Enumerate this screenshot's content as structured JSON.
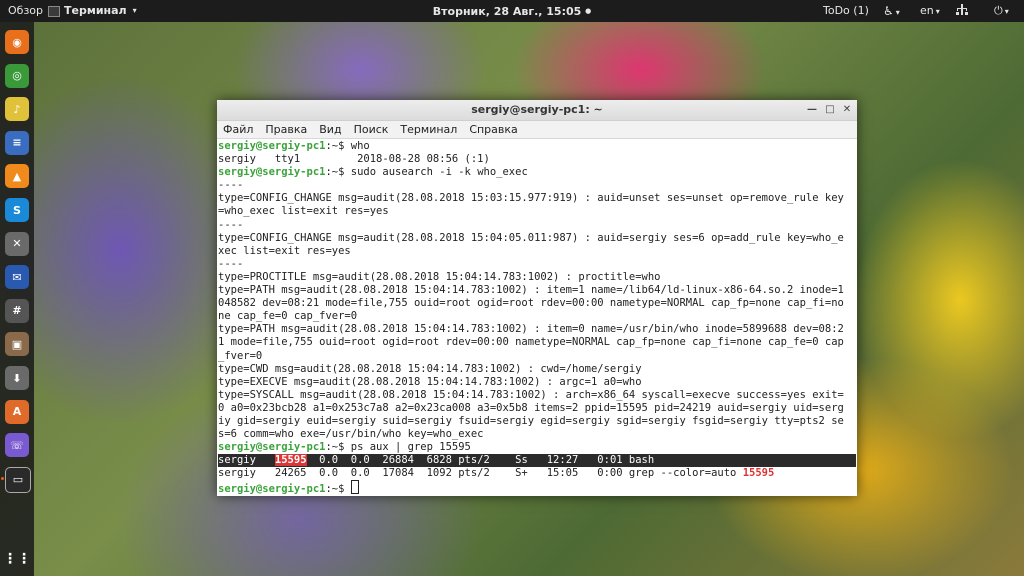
{
  "topbar": {
    "overview": "Обзор",
    "app_menu": "Терминал",
    "clock": "Вторник, 28 Авг., 15:05",
    "todo": "ToDo (1)",
    "language": "en",
    "icons": [
      "accessibility-icon",
      "network-icon",
      "power-icon"
    ]
  },
  "dock": {
    "items": [
      {
        "name": "firefox",
        "color": "#e8701c"
      },
      {
        "name": "chrome",
        "color": "#3a9a3a"
      },
      {
        "name": "rhythmbox",
        "color": "#e0c23a"
      },
      {
        "name": "libreoffice-writer",
        "color": "#3a6cc0"
      },
      {
        "name": "vlc",
        "color": "#f08a1c"
      },
      {
        "name": "skype",
        "color": "#1a8ad8"
      },
      {
        "name": "settings",
        "color": "#6a6a6a"
      },
      {
        "name": "thunderbird",
        "color": "#2a5ab0"
      },
      {
        "name": "calculator",
        "color": "#555555"
      },
      {
        "name": "files",
        "color": "#8a6a4a"
      },
      {
        "name": "installer",
        "color": "#6a6a6a"
      },
      {
        "name": "software-center",
        "color": "#e06a2a"
      },
      {
        "name": "viber",
        "color": "#7a5ad0"
      },
      {
        "name": "terminal",
        "color": "#2a2a2a"
      }
    ],
    "show_apps": "⋮⋮"
  },
  "window": {
    "title": "sergiy@sergiy-pc1: ~",
    "menu": [
      "Файл",
      "Правка",
      "Вид",
      "Поиск",
      "Терминал",
      "Справка"
    ]
  },
  "terminal": {
    "prompt": "sergiy@sergiy-pc1",
    "suffix": ":~$ ",
    "lines": [
      {
        "type": "cmd",
        "text": "who"
      },
      {
        "type": "out",
        "text": "sergiy   tty1         2018-08-28 08:56 (:1)"
      },
      {
        "type": "cmd",
        "text": "sudo ausearch -i -k who_exec"
      },
      {
        "type": "out",
        "text": "----"
      },
      {
        "type": "out",
        "text": "type=CONFIG_CHANGE msg=audit(28.08.2018 15:03:15.977:919) : auid=unset ses=unset op=remove_rule key"
      },
      {
        "type": "out",
        "text": "=who_exec list=exit res=yes"
      },
      {
        "type": "out",
        "text": "----"
      },
      {
        "type": "out",
        "text": "type=CONFIG_CHANGE msg=audit(28.08.2018 15:04:05.011:987) : auid=sergiy ses=6 op=add_rule key=who_e"
      },
      {
        "type": "out",
        "text": "xec list=exit res=yes"
      },
      {
        "type": "out",
        "text": "----"
      },
      {
        "type": "out",
        "text": "type=PROCTITLE msg=audit(28.08.2018 15:04:14.783:1002) : proctitle=who"
      },
      {
        "type": "out",
        "text": "type=PATH msg=audit(28.08.2018 15:04:14.783:1002) : item=1 name=/lib64/ld-linux-x86-64.so.2 inode=1"
      },
      {
        "type": "out",
        "text": "048582 dev=08:21 mode=file,755 ouid=root ogid=root rdev=00:00 nametype=NORMAL cap_fp=none cap_fi=no"
      },
      {
        "type": "out",
        "text": "ne cap_fe=0 cap_fver=0"
      },
      {
        "type": "out",
        "text": "type=PATH msg=audit(28.08.2018 15:04:14.783:1002) : item=0 name=/usr/bin/who inode=5899688 dev=08:2"
      },
      {
        "type": "out",
        "text": "1 mode=file,755 ouid=root ogid=root rdev=00:00 nametype=NORMAL cap_fp=none cap_fi=none cap_fe=0 cap"
      },
      {
        "type": "out",
        "text": "_fver=0"
      },
      {
        "type": "out",
        "text": "type=CWD msg=audit(28.08.2018 15:04:14.783:1002) : cwd=/home/sergiy"
      },
      {
        "type": "out",
        "text": "type=EXECVE msg=audit(28.08.2018 15:04:14.783:1002) : argc=1 a0=who"
      },
      {
        "type": "out",
        "text": "type=SYSCALL msg=audit(28.08.2018 15:04:14.783:1002) : arch=x86_64 syscall=execve success=yes exit="
      },
      {
        "type": "out",
        "text": "0 a0=0x23bcb28 a1=0x253c7a8 a2=0x23ca008 a3=0x5b8 items=2 ppid=15595 pid=24219 auid=sergiy uid=serg"
      },
      {
        "type": "out",
        "text": "iy gid=sergiy euid=sergiy suid=sergiy fsuid=sergiy egid=sergiy sgid=sergiy fsgid=sergiy tty=pts2 se"
      },
      {
        "type": "out",
        "text": "s=6 comm=who exe=/usr/bin/who key=who_exec"
      },
      {
        "type": "cmd",
        "text": "ps aux | grep 15595"
      },
      {
        "type": "hl",
        "pre": "sergiy   ",
        "match": "15595",
        "post": "  0.0  0.0  26884  6828 pts/2    Ss   12:27   0:01 bash"
      },
      {
        "type": "grep",
        "pre": "sergiy   24265  0.0  0.0  17084  1092 pts/2    S+   15:05   0:00 grep --color=auto ",
        "match": "15595"
      },
      {
        "type": "cmd",
        "text": ""
      }
    ]
  }
}
